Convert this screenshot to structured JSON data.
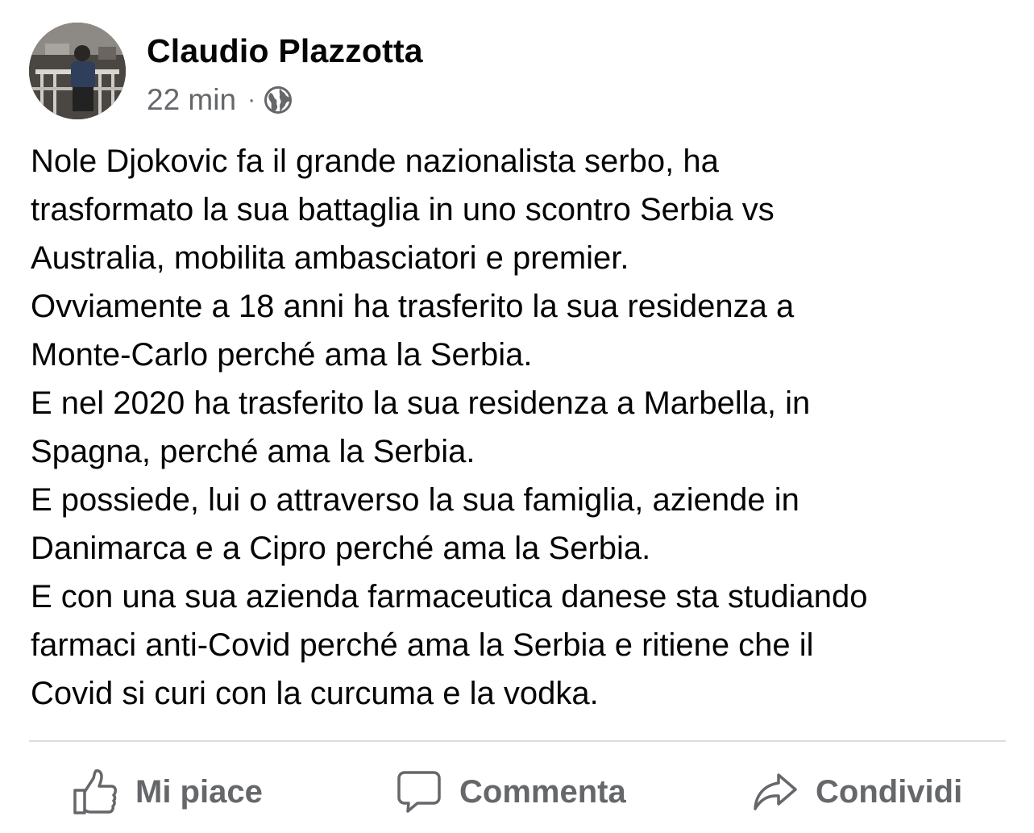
{
  "post": {
    "author": "Claudio Plazzotta",
    "time": "22 min",
    "separator": "·",
    "audience_icon": "globe-icon",
    "avatar": "profile-photo",
    "lines": [
      "Nole Djokovic fa il grande nazionalista serbo, ha",
      "trasformato la sua battaglia in uno scontro Serbia vs",
      "Australia, mobilita ambasciatori e premier.",
      "Ovviamente a 18 anni ha trasferito la sua residenza a",
      "Monte-Carlo perché ama la Serbia.",
      "E nel 2020 ha trasferito la sua residenza a Marbella, in",
      "Spagna, perché ama la Serbia.",
      "E possiede, lui o attraverso la sua famiglia, aziende in",
      "Danimarca e a Cipro perché ama la Serbia.",
      "E con una sua azienda farmaceutica danese sta studiando",
      "farmaci anti-Covid perché ama la Serbia e ritiene che il",
      "Covid si curi con la curcuma e la vodka."
    ]
  },
  "actions": {
    "like": {
      "label": "Mi piace",
      "icon": "thumbs-up-icon"
    },
    "comment": {
      "label": "Commenta",
      "icon": "comment-bubble-icon"
    },
    "share": {
      "label": "Condividi",
      "icon": "share-arrow-icon"
    }
  },
  "colors": {
    "text": "#050505",
    "secondary": "#65676b",
    "divider": "#dadde1"
  }
}
